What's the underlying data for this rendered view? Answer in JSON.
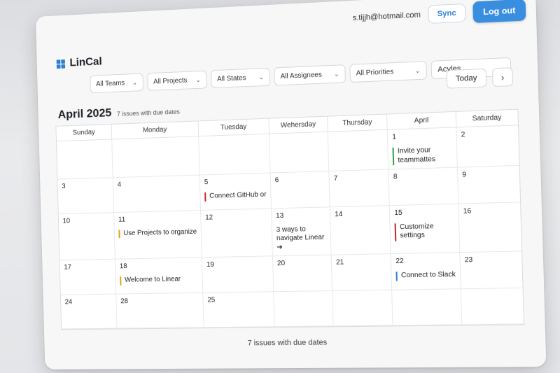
{
  "header": {
    "email": "s.tijjh@hotmail.com",
    "sync_label": "Sync",
    "logout_label": "Log out"
  },
  "brand": {
    "name": "LinCal"
  },
  "filters": {
    "teams": "All Teams",
    "projects": "All Projects",
    "states": "All States",
    "assignees": "All Assignees",
    "priorities": "All Priorities",
    "cycles": "Acyles"
  },
  "nav": {
    "today_label": "Today",
    "next_icon": "chevron-right-icon"
  },
  "calendar": {
    "month_label": "April 2025",
    "subtitle": "7 issues with due dates",
    "weekdays": [
      "Sunday",
      "Monday",
      "Tuesday",
      "Wehersday",
      "Thursday",
      "April",
      "Saturday"
    ],
    "weeks": [
      [
        {
          "day": ""
        },
        {
          "day": ""
        },
        {
          "day": ""
        },
        {
          "day": ""
        },
        {
          "day": ""
        },
        {
          "day": "1",
          "issue": "Invite your teammattes",
          "color": "#2da44e"
        },
        {
          "day": "2"
        }
      ],
      [
        {
          "day": "3"
        },
        {
          "day": "4"
        },
        {
          "day": "5",
          "issue": "Connect GitHub or",
          "color": "#d1242f"
        },
        {
          "day": "6"
        },
        {
          "day": "7"
        },
        {
          "day": "8"
        },
        {
          "day": "9"
        }
      ],
      [
        {
          "day": "10"
        },
        {
          "day": "11",
          "issue": "Use Projects to organize",
          "color": "#e3a008"
        },
        {
          "day": "12"
        },
        {
          "day": "13",
          "issue": "3 ways to navigate Linear ➔",
          "color": ""
        },
        {
          "day": "14"
        },
        {
          "day": "15",
          "issue": "Customize settings",
          "color": "#d1242f"
        },
        {
          "day": "16"
        }
      ],
      [
        {
          "day": "17"
        },
        {
          "day": "18",
          "issue": "Welcome to Linear",
          "color": "#e3a008"
        },
        {
          "day": "19"
        },
        {
          "day": "20"
        },
        {
          "day": "21"
        },
        {
          "day": "22",
          "issue": "Connect to Slack",
          "color": "#2f80d1"
        },
        {
          "day": "23"
        }
      ],
      [
        {
          "day": "24"
        },
        {
          "day": "28"
        },
        {
          "day": "25"
        },
        {
          "day": ""
        },
        {
          "day": ""
        },
        {
          "day": ""
        },
        {
          "day": ""
        }
      ]
    ]
  },
  "footer": {
    "summary": "7 issues with due dates"
  }
}
